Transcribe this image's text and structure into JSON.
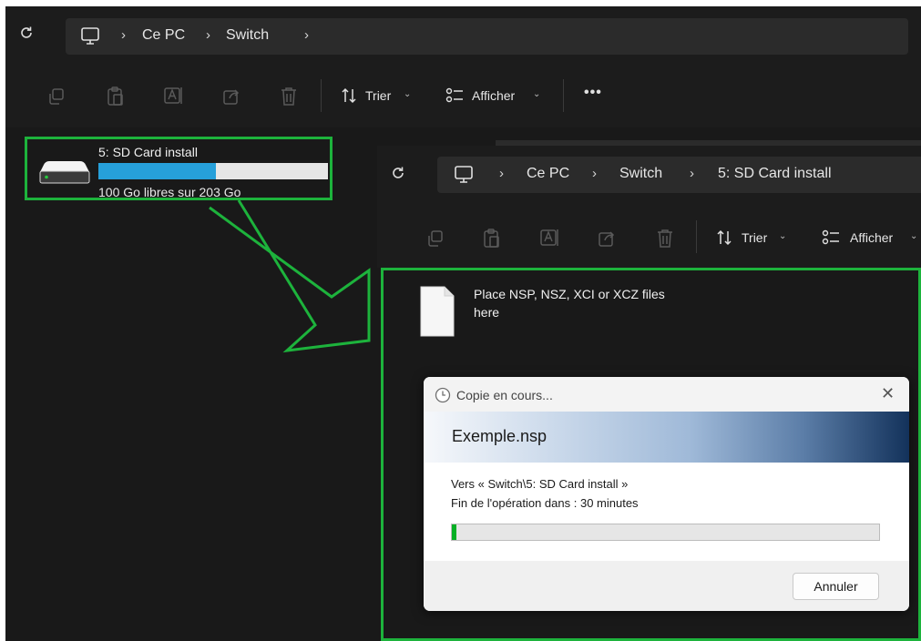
{
  "back_window": {
    "breadcrumb": [
      "Ce PC",
      "Switch"
    ],
    "toolbar": {
      "sort_label": "Trier",
      "view_label": "Afficher",
      "more_label": "•••"
    },
    "drive": {
      "label": "5: SD Card install",
      "space_text": "100 Go libres sur 203 Go",
      "used_fraction": 0.51
    }
  },
  "front_window": {
    "breadcrumb": [
      "Ce PC",
      "Switch",
      "5: SD Card install"
    ],
    "toolbar": {
      "sort_label": "Trier",
      "view_label": "Afficher"
    },
    "file": {
      "name_line1": "Place NSP, NSZ, XCI or XCZ files",
      "name_line2": "here"
    }
  },
  "copy_dialog": {
    "title": "Copie en cours...",
    "filename": "Exemple.nsp",
    "destination": "Vers « Switch\\5: SD Card install »",
    "eta": "Fin de l'opération dans : 30 minutes",
    "progress_fraction": 0.01,
    "cancel_label": "Annuler"
  },
  "colors": {
    "highlight": "#1db33c",
    "drive_bar": "#26a0da",
    "progress": "#06b025"
  }
}
